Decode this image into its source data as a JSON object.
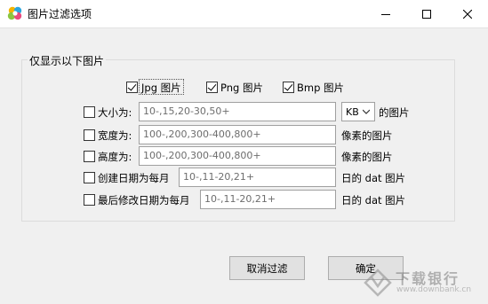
{
  "window": {
    "title": "图片过滤选项",
    "icon": "colorful-petal-app-icon",
    "controls": [
      "minimize-icon",
      "maximize-icon",
      "close-icon"
    ]
  },
  "group": {
    "title": "仅显示以下图片"
  },
  "formats": [
    {
      "label": "Jpg 图片",
      "checked": true
    },
    {
      "label": "Png 图片",
      "checked": true
    },
    {
      "label": "Bmp 图片",
      "checked": true
    }
  ],
  "filters": {
    "size": {
      "label": "大小为:",
      "checked": false,
      "value": "10-,15,20-30,50+",
      "unit": "KB",
      "suffix": "的图片"
    },
    "width": {
      "label": "宽度为:",
      "checked": false,
      "value": "100-,200,300-400,800+",
      "suffix": "像素的图片"
    },
    "height": {
      "label": "高度为:",
      "checked": false,
      "value": "100-,200,300-400,800+",
      "suffix": "像素的图片"
    },
    "created": {
      "label": "创建日期为每月",
      "checked": false,
      "value": "10-,11-20,21+",
      "suffix": "日的 dat 图片"
    },
    "modified": {
      "label": "最后修改日期为每月",
      "checked": false,
      "value": "10-,11-20,21+",
      "suffix": "日的 dat 图片"
    }
  },
  "buttons": {
    "cancel_filter": "取消过滤",
    "ok": "确定"
  },
  "watermark": {
    "name": "下载银行",
    "url": "www.downbank.cn"
  }
}
